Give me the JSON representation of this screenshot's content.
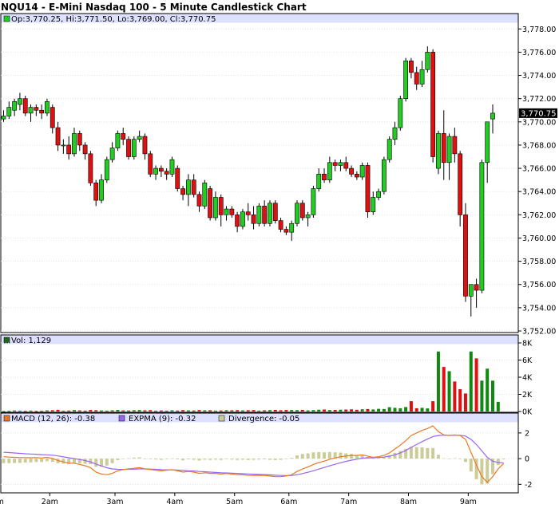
{
  "chart_data": [
    {
      "type": "candlestick",
      "title": "NQU14 - E-Mini Nasdaq 100 - 5 Minute Candlestick Chart",
      "legend": "Op:3,770.25, Hi:3,771.50, Lo:3,769.00, Cl:3,770.75",
      "last_price": "3,770.75",
      "y_ticks": [
        "3,752.00",
        "3,754.00",
        "3,756.00",
        "3,758.00",
        "3,760.00",
        "3,762.00",
        "3,764.00",
        "3,766.00",
        "3,768.00",
        "3,770.00",
        "3,772.00",
        "3,774.00",
        "3,776.00",
        "3,778.00"
      ],
      "ylim": [
        3752,
        3778.5
      ],
      "grid": true,
      "colors": {
        "up": "#22cc22",
        "down": "#dd1111",
        "header": "#dde0ff",
        "legend_swatch": "#22cc22"
      },
      "candles": [
        {
          "o": 3770.25,
          "h": 3771.0,
          "l": 3770.0,
          "c": 3770.5
        },
        {
          "o": 3770.5,
          "h": 3771.75,
          "l": 3770.25,
          "c": 3771.25
        },
        {
          "o": 3771.0,
          "h": 3772.0,
          "l": 3770.5,
          "c": 3771.75
        },
        {
          "o": 3771.5,
          "h": 3772.5,
          "l": 3771.0,
          "c": 3772.0
        },
        {
          "o": 3772.0,
          "h": 3772.25,
          "l": 3770.5,
          "c": 3770.75
        },
        {
          "o": 3770.75,
          "h": 3771.5,
          "l": 3770.0,
          "c": 3771.25
        },
        {
          "o": 3771.25,
          "h": 3771.5,
          "l": 3770.5,
          "c": 3771.0
        },
        {
          "o": 3771.0,
          "h": 3771.5,
          "l": 3770.25,
          "c": 3770.75
        },
        {
          "o": 3770.75,
          "h": 3772.0,
          "l": 3770.5,
          "c": 3771.75
        },
        {
          "o": 3771.25,
          "h": 3771.5,
          "l": 3769.0,
          "c": 3769.5
        },
        {
          "o": 3769.5,
          "h": 3770.0,
          "l": 3767.5,
          "c": 3768.0
        },
        {
          "o": 3768.0,
          "h": 3768.5,
          "l": 3767.25,
          "c": 3768.0
        },
        {
          "o": 3768.0,
          "h": 3768.75,
          "l": 3766.75,
          "c": 3767.25
        },
        {
          "o": 3767.25,
          "h": 3769.5,
          "l": 3767.0,
          "c": 3769.0
        },
        {
          "o": 3769.0,
          "h": 3769.25,
          "l": 3767.5,
          "c": 3768.0
        },
        {
          "o": 3768.0,
          "h": 3768.25,
          "l": 3766.75,
          "c": 3767.25
        },
        {
          "o": 3767.25,
          "h": 3767.5,
          "l": 3764.5,
          "c": 3764.75
        },
        {
          "o": 3764.75,
          "h": 3765.0,
          "l": 3762.75,
          "c": 3763.25
        },
        {
          "o": 3763.25,
          "h": 3765.5,
          "l": 3763.0,
          "c": 3765.0
        },
        {
          "o": 3765.0,
          "h": 3767.0,
          "l": 3764.75,
          "c": 3766.75
        },
        {
          "o": 3766.75,
          "h": 3768.25,
          "l": 3766.5,
          "c": 3767.75
        },
        {
          "o": 3767.75,
          "h": 3769.25,
          "l": 3767.5,
          "c": 3769.0
        },
        {
          "o": 3769.0,
          "h": 3769.5,
          "l": 3768.0,
          "c": 3768.5
        },
        {
          "o": 3768.5,
          "h": 3768.75,
          "l": 3766.75,
          "c": 3767.0
        },
        {
          "o": 3767.0,
          "h": 3768.75,
          "l": 3766.75,
          "c": 3768.5
        },
        {
          "o": 3768.5,
          "h": 3769.25,
          "l": 3768.25,
          "c": 3768.75
        },
        {
          "o": 3768.75,
          "h": 3769.0,
          "l": 3766.75,
          "c": 3767.25
        },
        {
          "o": 3767.25,
          "h": 3767.5,
          "l": 3765.25,
          "c": 3765.5
        },
        {
          "o": 3765.5,
          "h": 3766.25,
          "l": 3765.0,
          "c": 3766.0
        },
        {
          "o": 3766.0,
          "h": 3766.25,
          "l": 3765.25,
          "c": 3765.75
        },
        {
          "o": 3765.75,
          "h": 3766.0,
          "l": 3765.0,
          "c": 3765.5
        },
        {
          "o": 3765.5,
          "h": 3767.0,
          "l": 3765.25,
          "c": 3766.75
        },
        {
          "o": 3766.0,
          "h": 3766.25,
          "l": 3764.0,
          "c": 3764.25
        },
        {
          "o": 3764.25,
          "h": 3764.5,
          "l": 3763.25,
          "c": 3763.75
        },
        {
          "o": 3763.75,
          "h": 3765.5,
          "l": 3762.75,
          "c": 3765.0
        },
        {
          "o": 3765.0,
          "h": 3765.5,
          "l": 3763.5,
          "c": 3763.75
        },
        {
          "o": 3763.75,
          "h": 3764.0,
          "l": 3762.25,
          "c": 3762.75
        },
        {
          "o": 3762.75,
          "h": 3765.0,
          "l": 3762.5,
          "c": 3764.75
        },
        {
          "o": 3764.25,
          "h": 3764.5,
          "l": 3761.5,
          "c": 3761.75
        },
        {
          "o": 3761.75,
          "h": 3764.0,
          "l": 3761.5,
          "c": 3763.5
        },
        {
          "o": 3763.5,
          "h": 3763.75,
          "l": 3761.0,
          "c": 3762.0
        },
        {
          "o": 3762.0,
          "h": 3762.75,
          "l": 3761.5,
          "c": 3762.5
        },
        {
          "o": 3762.5,
          "h": 3762.75,
          "l": 3761.75,
          "c": 3762.0
        },
        {
          "o": 3762.0,
          "h": 3762.25,
          "l": 3760.5,
          "c": 3761.0
        },
        {
          "o": 3761.0,
          "h": 3762.5,
          "l": 3760.75,
          "c": 3762.25
        },
        {
          "o": 3762.25,
          "h": 3763.0,
          "l": 3761.5,
          "c": 3762.0
        },
        {
          "o": 3762.0,
          "h": 3762.75,
          "l": 3760.75,
          "c": 3761.25
        },
        {
          "o": 3761.25,
          "h": 3763.0,
          "l": 3761.0,
          "c": 3762.75
        },
        {
          "o": 3762.75,
          "h": 3763.25,
          "l": 3761.0,
          "c": 3761.25
        },
        {
          "o": 3761.25,
          "h": 3763.25,
          "l": 3761.0,
          "c": 3763.0
        },
        {
          "o": 3763.0,
          "h": 3763.25,
          "l": 3761.25,
          "c": 3761.5
        },
        {
          "o": 3761.5,
          "h": 3761.75,
          "l": 3760.5,
          "c": 3760.75
        },
        {
          "o": 3760.75,
          "h": 3761.0,
          "l": 3760.25,
          "c": 3760.5
        },
        {
          "o": 3760.5,
          "h": 3761.5,
          "l": 3759.75,
          "c": 3761.25
        },
        {
          "o": 3761.25,
          "h": 3763.25,
          "l": 3761.0,
          "c": 3763.0
        },
        {
          "o": 3763.0,
          "h": 3763.25,
          "l": 3761.5,
          "c": 3761.75
        },
        {
          "o": 3761.75,
          "h": 3762.25,
          "l": 3761.0,
          "c": 3762.0
        },
        {
          "o": 3762.0,
          "h": 3764.5,
          "l": 3761.75,
          "c": 3764.25
        },
        {
          "o": 3764.25,
          "h": 3766.0,
          "l": 3764.0,
          "c": 3765.5
        },
        {
          "o": 3765.5,
          "h": 3766.0,
          "l": 3764.75,
          "c": 3765.0
        },
        {
          "o": 3765.0,
          "h": 3767.0,
          "l": 3764.75,
          "c": 3766.5
        },
        {
          "o": 3766.5,
          "h": 3766.75,
          "l": 3765.75,
          "c": 3766.25
        },
        {
          "o": 3766.25,
          "h": 3766.75,
          "l": 3765.75,
          "c": 3766.5
        },
        {
          "o": 3766.5,
          "h": 3767.0,
          "l": 3765.75,
          "c": 3766.0
        },
        {
          "o": 3766.0,
          "h": 3766.25,
          "l": 3765.25,
          "c": 3765.5
        },
        {
          "o": 3765.5,
          "h": 3765.75,
          "l": 3765.0,
          "c": 3765.25
        },
        {
          "o": 3765.25,
          "h": 3766.5,
          "l": 3765.0,
          "c": 3766.25
        },
        {
          "o": 3766.25,
          "h": 3766.5,
          "l": 3761.75,
          "c": 3762.25
        },
        {
          "o": 3762.25,
          "h": 3764.0,
          "l": 3762.0,
          "c": 3763.5
        },
        {
          "o": 3763.5,
          "h": 3764.25,
          "l": 3763.25,
          "c": 3764.0
        },
        {
          "o": 3764.0,
          "h": 3767.0,
          "l": 3763.75,
          "c": 3766.75
        },
        {
          "o": 3766.75,
          "h": 3768.75,
          "l": 3766.5,
          "c": 3768.5
        },
        {
          "o": 3768.5,
          "h": 3770.0,
          "l": 3768.0,
          "c": 3769.5
        },
        {
          "o": 3769.5,
          "h": 3772.25,
          "l": 3769.25,
          "c": 3772.0
        },
        {
          "o": 3772.0,
          "h": 3775.5,
          "l": 3771.75,
          "c": 3775.25
        },
        {
          "o": 3775.25,
          "h": 3775.5,
          "l": 3773.75,
          "c": 3774.25
        },
        {
          "o": 3774.25,
          "h": 3774.75,
          "l": 3772.75,
          "c": 3773.25
        },
        {
          "o": 3773.25,
          "h": 3775.25,
          "l": 3773.0,
          "c": 3774.5
        },
        {
          "o": 3774.5,
          "h": 3776.5,
          "l": 3774.25,
          "c": 3776.0
        },
        {
          "o": 3776.0,
          "h": 3776.25,
          "l": 3766.5,
          "c": 3767.0
        },
        {
          "o": 3766.0,
          "h": 3769.25,
          "l": 3765.5,
          "c": 3769.0
        },
        {
          "o": 3769.0,
          "h": 3771.0,
          "l": 3765.0,
          "c": 3766.5
        },
        {
          "o": 3766.5,
          "h": 3769.0,
          "l": 3765.0,
          "c": 3768.75
        },
        {
          "o": 3768.75,
          "h": 3769.5,
          "l": 3766.5,
          "c": 3767.25
        },
        {
          "o": 3767.25,
          "h": 3767.5,
          "l": 3761.0,
          "c": 3762.0
        },
        {
          "o": 3762.0,
          "h": 3763.0,
          "l": 3754.5,
          "c": 3755.0
        },
        {
          "o": 3755.0,
          "h": 3756.0,
          "l": 3753.25,
          "c": 3756.0
        },
        {
          "o": 3756.0,
          "h": 3756.5,
          "l": 3754.0,
          "c": 3755.5
        },
        {
          "o": 3755.5,
          "h": 3766.75,
          "l": 3755.25,
          "c": 3766.5
        },
        {
          "o": 3766.5,
          "h": 3770.0,
          "l": 3764.75,
          "c": 3770.0
        },
        {
          "o": 3770.25,
          "h": 3771.5,
          "l": 3769.0,
          "c": 3770.75
        }
      ]
    },
    {
      "type": "bar",
      "title": "Vol: 1,129",
      "y_ticks": [
        "0K",
        "2K",
        "4K",
        "6K",
        "8K"
      ],
      "ylim": [
        0,
        8000
      ],
      "values": [
        40,
        80,
        120,
        90,
        70,
        110,
        60,
        80,
        130,
        150,
        200,
        90,
        110,
        160,
        130,
        100,
        180,
        150,
        120,
        100,
        140,
        180,
        130,
        110,
        150,
        170,
        140,
        160,
        100,
        120,
        90,
        140,
        110,
        160,
        130,
        120,
        170,
        140,
        150,
        100,
        120,
        150,
        140,
        160,
        130,
        150,
        170,
        100,
        140,
        160,
        190,
        150,
        180,
        170,
        160,
        190,
        130,
        170,
        210,
        230,
        170,
        190,
        210,
        230,
        250,
        200,
        260,
        290,
        240,
        310,
        290,
        500,
        430,
        380,
        520,
        1200,
        380,
        430,
        360,
        1200,
        7000,
        5200,
        4700,
        3500,
        2600,
        2100,
        7000,
        6200,
        3600,
        5000,
        3600,
        1129
      ]
    },
    {
      "type": "line",
      "legend": [
        "MACD (12, 26): -0.38",
        "EXPMA (9): -0.32",
        "Divergence: -0.05"
      ],
      "y_ticks": [
        "-2",
        "0",
        "2"
      ],
      "ylim": [
        -2.6,
        2.8
      ],
      "colors": {
        "macd": "#ee7722",
        "expma": "#9966ee",
        "divergence": "#cccc99"
      },
      "x_labels": [
        "1am",
        "2am",
        "3am",
        "4am",
        "5am",
        "6am",
        "7am",
        "8am",
        "9am"
      ],
      "macd": [
        0.15,
        0.12,
        0.1,
        0.08,
        0.08,
        0.07,
        0.08,
        0.05,
        0.1,
        0.02,
        -0.15,
        -0.25,
        -0.35,
        -0.35,
        -0.45,
        -0.55,
        -0.7,
        -1.05,
        -1.2,
        -1.25,
        -1.15,
        -0.95,
        -0.85,
        -0.8,
        -0.75,
        -0.7,
        -0.8,
        -0.85,
        -0.9,
        -0.95,
        -0.9,
        -0.85,
        -0.95,
        -1.05,
        -1.0,
        -1.05,
        -1.15,
        -1.1,
        -1.15,
        -1.15,
        -1.2,
        -1.15,
        -1.2,
        -1.25,
        -1.25,
        -1.3,
        -1.3,
        -1.3,
        -1.3,
        -1.35,
        -1.4,
        -1.4,
        -1.35,
        -1.25,
        -1.0,
        -0.8,
        -0.65,
        -0.45,
        -0.3,
        -0.2,
        -0.05,
        0.05,
        0.15,
        0.2,
        0.25,
        0.25,
        0.3,
        0.2,
        0.1,
        0.15,
        0.25,
        0.45,
        0.75,
        1.05,
        1.4,
        1.8,
        2.0,
        2.2,
        2.35,
        2.55,
        2.1,
        1.85,
        1.8,
        1.85,
        1.8,
        1.5,
        0.5,
        -0.5,
        -1.4,
        -1.85,
        -1.4,
        -0.8,
        -0.38
      ],
      "expma": [
        0.5,
        0.47,
        0.44,
        0.41,
        0.38,
        0.36,
        0.34,
        0.31,
        0.3,
        0.27,
        0.21,
        0.14,
        0.07,
        0.0,
        -0.07,
        -0.15,
        -0.26,
        -0.42,
        -0.57,
        -0.71,
        -0.8,
        -0.83,
        -0.84,
        -0.83,
        -0.82,
        -0.8,
        -0.8,
        -0.81,
        -0.83,
        -0.86,
        -0.87,
        -0.87,
        -0.89,
        -0.92,
        -0.94,
        -0.96,
        -1.0,
        -1.02,
        -1.05,
        -1.07,
        -1.1,
        -1.11,
        -1.13,
        -1.15,
        -1.17,
        -1.19,
        -1.21,
        -1.23,
        -1.24,
        -1.26,
        -1.29,
        -1.31,
        -1.32,
        -1.31,
        -1.25,
        -1.16,
        -1.06,
        -0.94,
        -0.81,
        -0.69,
        -0.56,
        -0.44,
        -0.32,
        -0.21,
        -0.12,
        -0.04,
        0.03,
        0.07,
        0.07,
        0.09,
        0.12,
        0.19,
        0.3,
        0.45,
        0.64,
        0.88,
        1.1,
        1.32,
        1.52,
        1.72,
        1.8,
        1.82,
        1.82,
        1.82,
        1.82,
        1.76,
        1.5,
        1.1,
        0.6,
        0.1,
        -0.2,
        -0.3,
        -0.32
      ]
    }
  ]
}
